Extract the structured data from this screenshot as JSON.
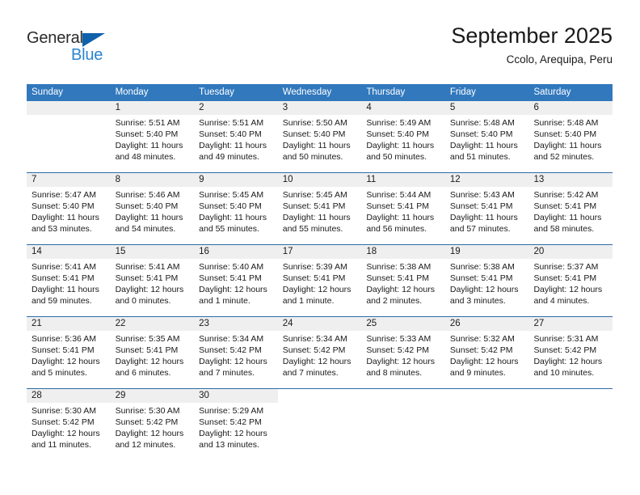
{
  "brand": {
    "name_part1": "General",
    "name_part2": "Blue",
    "triangle_color": "#1061ac",
    "blue_color": "#2a84d2"
  },
  "header": {
    "title": "September 2025",
    "subtitle": "Ccolo, Arequipa, Peru"
  },
  "theme": {
    "header_row_bg": "#3178bd",
    "header_row_text": "#ffffff",
    "day_band_bg": "#efefef",
    "week_divider": "#2e6ca4"
  },
  "weekdays": [
    "Sunday",
    "Monday",
    "Tuesday",
    "Wednesday",
    "Thursday",
    "Friday",
    "Saturday"
  ],
  "weeks": [
    [
      {
        "day": "",
        "lines": []
      },
      {
        "day": "1",
        "lines": [
          "Sunrise: 5:51 AM",
          "Sunset: 5:40 PM",
          "Daylight: 11 hours",
          "and 48 minutes."
        ]
      },
      {
        "day": "2",
        "lines": [
          "Sunrise: 5:51 AM",
          "Sunset: 5:40 PM",
          "Daylight: 11 hours",
          "and 49 minutes."
        ]
      },
      {
        "day": "3",
        "lines": [
          "Sunrise: 5:50 AM",
          "Sunset: 5:40 PM",
          "Daylight: 11 hours",
          "and 50 minutes."
        ]
      },
      {
        "day": "4",
        "lines": [
          "Sunrise: 5:49 AM",
          "Sunset: 5:40 PM",
          "Daylight: 11 hours",
          "and 50 minutes."
        ]
      },
      {
        "day": "5",
        "lines": [
          "Sunrise: 5:48 AM",
          "Sunset: 5:40 PM",
          "Daylight: 11 hours",
          "and 51 minutes."
        ]
      },
      {
        "day": "6",
        "lines": [
          "Sunrise: 5:48 AM",
          "Sunset: 5:40 PM",
          "Daylight: 11 hours",
          "and 52 minutes."
        ]
      }
    ],
    [
      {
        "day": "7",
        "lines": [
          "Sunrise: 5:47 AM",
          "Sunset: 5:40 PM",
          "Daylight: 11 hours",
          "and 53 minutes."
        ]
      },
      {
        "day": "8",
        "lines": [
          "Sunrise: 5:46 AM",
          "Sunset: 5:40 PM",
          "Daylight: 11 hours",
          "and 54 minutes."
        ]
      },
      {
        "day": "9",
        "lines": [
          "Sunrise: 5:45 AM",
          "Sunset: 5:40 PM",
          "Daylight: 11 hours",
          "and 55 minutes."
        ]
      },
      {
        "day": "10",
        "lines": [
          "Sunrise: 5:45 AM",
          "Sunset: 5:41 PM",
          "Daylight: 11 hours",
          "and 55 minutes."
        ]
      },
      {
        "day": "11",
        "lines": [
          "Sunrise: 5:44 AM",
          "Sunset: 5:41 PM",
          "Daylight: 11 hours",
          "and 56 minutes."
        ]
      },
      {
        "day": "12",
        "lines": [
          "Sunrise: 5:43 AM",
          "Sunset: 5:41 PM",
          "Daylight: 11 hours",
          "and 57 minutes."
        ]
      },
      {
        "day": "13",
        "lines": [
          "Sunrise: 5:42 AM",
          "Sunset: 5:41 PM",
          "Daylight: 11 hours",
          "and 58 minutes."
        ]
      }
    ],
    [
      {
        "day": "14",
        "lines": [
          "Sunrise: 5:41 AM",
          "Sunset: 5:41 PM",
          "Daylight: 11 hours",
          "and 59 minutes."
        ]
      },
      {
        "day": "15",
        "lines": [
          "Sunrise: 5:41 AM",
          "Sunset: 5:41 PM",
          "Daylight: 12 hours",
          "and 0 minutes."
        ]
      },
      {
        "day": "16",
        "lines": [
          "Sunrise: 5:40 AM",
          "Sunset: 5:41 PM",
          "Daylight: 12 hours",
          "and 1 minute."
        ]
      },
      {
        "day": "17",
        "lines": [
          "Sunrise: 5:39 AM",
          "Sunset: 5:41 PM",
          "Daylight: 12 hours",
          "and 1 minute."
        ]
      },
      {
        "day": "18",
        "lines": [
          "Sunrise: 5:38 AM",
          "Sunset: 5:41 PM",
          "Daylight: 12 hours",
          "and 2 minutes."
        ]
      },
      {
        "day": "19",
        "lines": [
          "Sunrise: 5:38 AM",
          "Sunset: 5:41 PM",
          "Daylight: 12 hours",
          "and 3 minutes."
        ]
      },
      {
        "day": "20",
        "lines": [
          "Sunrise: 5:37 AM",
          "Sunset: 5:41 PM",
          "Daylight: 12 hours",
          "and 4 minutes."
        ]
      }
    ],
    [
      {
        "day": "21",
        "lines": [
          "Sunrise: 5:36 AM",
          "Sunset: 5:41 PM",
          "Daylight: 12 hours",
          "and 5 minutes."
        ]
      },
      {
        "day": "22",
        "lines": [
          "Sunrise: 5:35 AM",
          "Sunset: 5:41 PM",
          "Daylight: 12 hours",
          "and 6 minutes."
        ]
      },
      {
        "day": "23",
        "lines": [
          "Sunrise: 5:34 AM",
          "Sunset: 5:42 PM",
          "Daylight: 12 hours",
          "and 7 minutes."
        ]
      },
      {
        "day": "24",
        "lines": [
          "Sunrise: 5:34 AM",
          "Sunset: 5:42 PM",
          "Daylight: 12 hours",
          "and 7 minutes."
        ]
      },
      {
        "day": "25",
        "lines": [
          "Sunrise: 5:33 AM",
          "Sunset: 5:42 PM",
          "Daylight: 12 hours",
          "and 8 minutes."
        ]
      },
      {
        "day": "26",
        "lines": [
          "Sunrise: 5:32 AM",
          "Sunset: 5:42 PM",
          "Daylight: 12 hours",
          "and 9 minutes."
        ]
      },
      {
        "day": "27",
        "lines": [
          "Sunrise: 5:31 AM",
          "Sunset: 5:42 PM",
          "Daylight: 12 hours",
          "and 10 minutes."
        ]
      }
    ],
    [
      {
        "day": "28",
        "lines": [
          "Sunrise: 5:30 AM",
          "Sunset: 5:42 PM",
          "Daylight: 12 hours",
          "and 11 minutes."
        ]
      },
      {
        "day": "29",
        "lines": [
          "Sunrise: 5:30 AM",
          "Sunset: 5:42 PM",
          "Daylight: 12 hours",
          "and 12 minutes."
        ]
      },
      {
        "day": "30",
        "lines": [
          "Sunrise: 5:29 AM",
          "Sunset: 5:42 PM",
          "Daylight: 12 hours",
          "and 13 minutes."
        ]
      },
      {
        "day": "",
        "lines": []
      },
      {
        "day": "",
        "lines": []
      },
      {
        "day": "",
        "lines": []
      },
      {
        "day": "",
        "lines": []
      }
    ]
  ]
}
